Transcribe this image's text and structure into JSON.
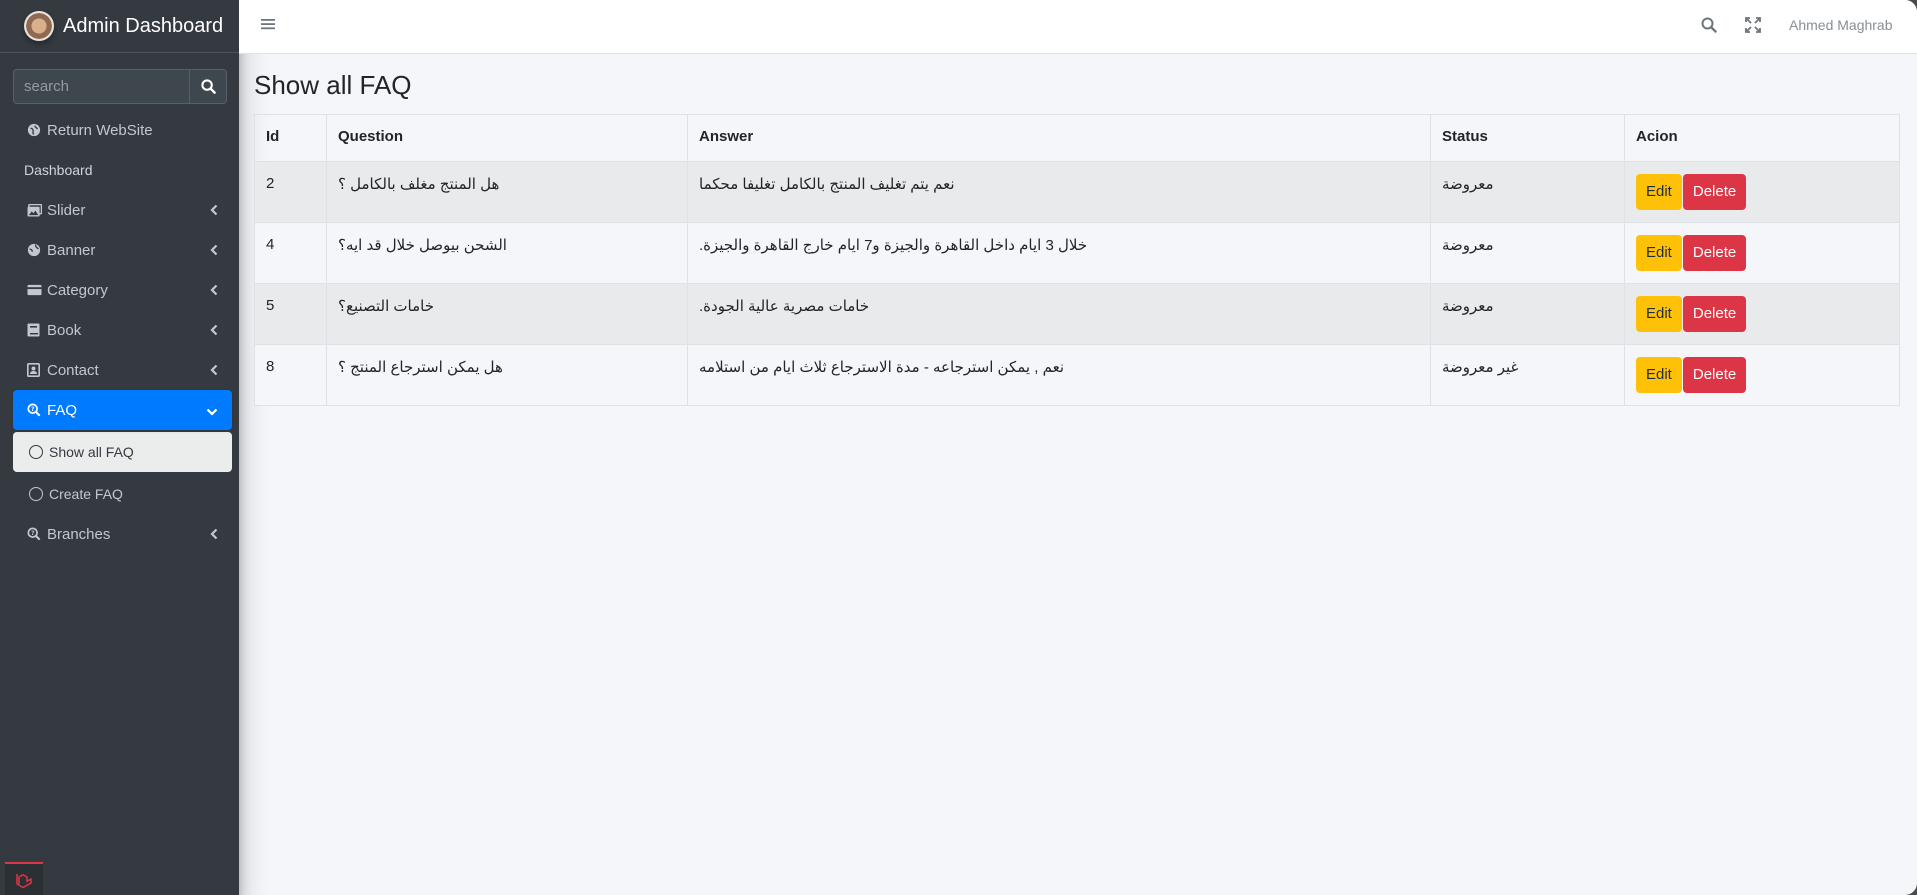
{
  "brand": {
    "title_bold": "Admin",
    "title_rest": " Dashboard"
  },
  "sidebar": {
    "search_placeholder": "search",
    "return_label": "Return WebSite",
    "header": "Dashboard",
    "items": [
      {
        "label": "Slider",
        "icon": "images-icon"
      },
      {
        "label": "Banner",
        "icon": "globe-icon"
      },
      {
        "label": "Category",
        "icon": "credit-card-icon"
      },
      {
        "label": "Book",
        "icon": "book-icon"
      },
      {
        "label": "Contact",
        "icon": "address-book-icon"
      },
      {
        "label": "FAQ",
        "icon": "question-search-icon"
      },
      {
        "label": "Branches",
        "icon": "question-search-icon"
      }
    ],
    "faq_sub": [
      "Show all FAQ",
      "Create FAQ"
    ]
  },
  "navbar": {
    "user": "Ahmed Maghrab"
  },
  "page": {
    "title": "Show all FAQ"
  },
  "table": {
    "headers": [
      "Id",
      "Question",
      "Answer",
      "Status",
      "Acion"
    ],
    "rows": [
      {
        "id": "2",
        "question": "هل المنتج مغلف بالكامل ؟",
        "answer": "نعم يتم تغليف المنتج بالكامل تغليفا محكما",
        "status": "معروضة"
      },
      {
        "id": "4",
        "question": "الشحن بيوصل خلال قد ايه؟",
        "answer": "خلال 3 ايام داخل القاهرة والجيزة و7 ايام خارج القاهرة والجيزة.",
        "status": "معروضة"
      },
      {
        "id": "5",
        "question": "خامات التصنيع؟",
        "answer": "خامات مصرية عالية الجودة.",
        "status": "معروضة"
      },
      {
        "id": "8",
        "question": "هل يمكن استرجاع المنتج ؟",
        "answer": "نعم , يمكن استرجاعه - مدة الاسترجاع ثلاث ايام من استلامه",
        "status": "غير معروضة"
      }
    ],
    "edit_label": "Edit",
    "delete_label": "Delete"
  },
  "colors": {
    "active": "#007bff",
    "edit": "#ffc107",
    "delete": "#dc3545",
    "sidebar": "#343a40"
  }
}
